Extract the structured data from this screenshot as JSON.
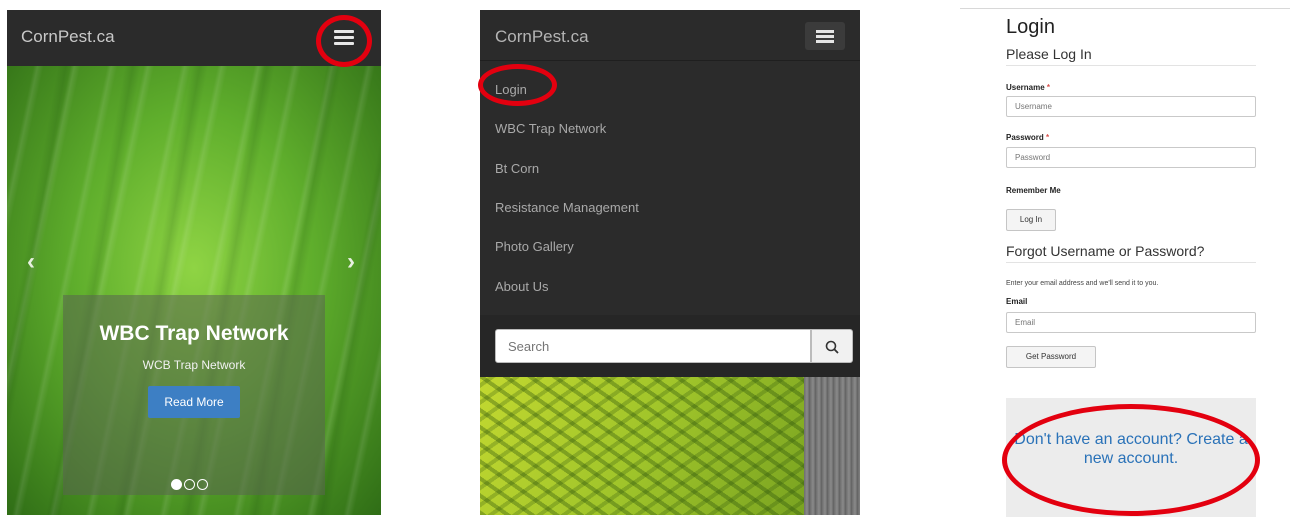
{
  "panel1": {
    "brand": "CornPest.ca",
    "prev_glyph": "‹",
    "next_glyph": "›",
    "slide": {
      "title": "WBC Trap Network",
      "subtitle": "WCB Trap Network",
      "button": "Read More"
    },
    "dots_total": 3,
    "active_dot": 1,
    "icons": [
      "hamburger-menu-icon",
      "chevron-left-icon",
      "chevron-right-icon"
    ]
  },
  "panel2": {
    "brand": "CornPest.ca",
    "menu_items": [
      "Login",
      "WBC Trap Network",
      "Bt Corn",
      "Resistance Management",
      "Photo Gallery",
      "About Us"
    ],
    "search_placeholder": "Search",
    "icons": [
      "hamburger-menu-icon",
      "search-icon"
    ]
  },
  "panel3": {
    "title": "Login",
    "subtitle": "Please Log In",
    "username_label": "Username",
    "username_placeholder": "Username",
    "password_label": "Password",
    "password_placeholder": "Password",
    "required_mark": "*",
    "remember_label": "Remember Me",
    "login_button": "Log In",
    "forgot_title": "Forgot Username or Password?",
    "forgot_help": "Enter your email address and we'll send it to you.",
    "email_label": "Email",
    "email_placeholder": "Email",
    "get_password_button": "Get Password",
    "create_account": "Don't have an account? Create a new account."
  },
  "colors": {
    "highlight": "#e3000f",
    "navbar": "#2b2b2b",
    "primary_button": "#3d7fc4",
    "link": "#2a72b8"
  }
}
